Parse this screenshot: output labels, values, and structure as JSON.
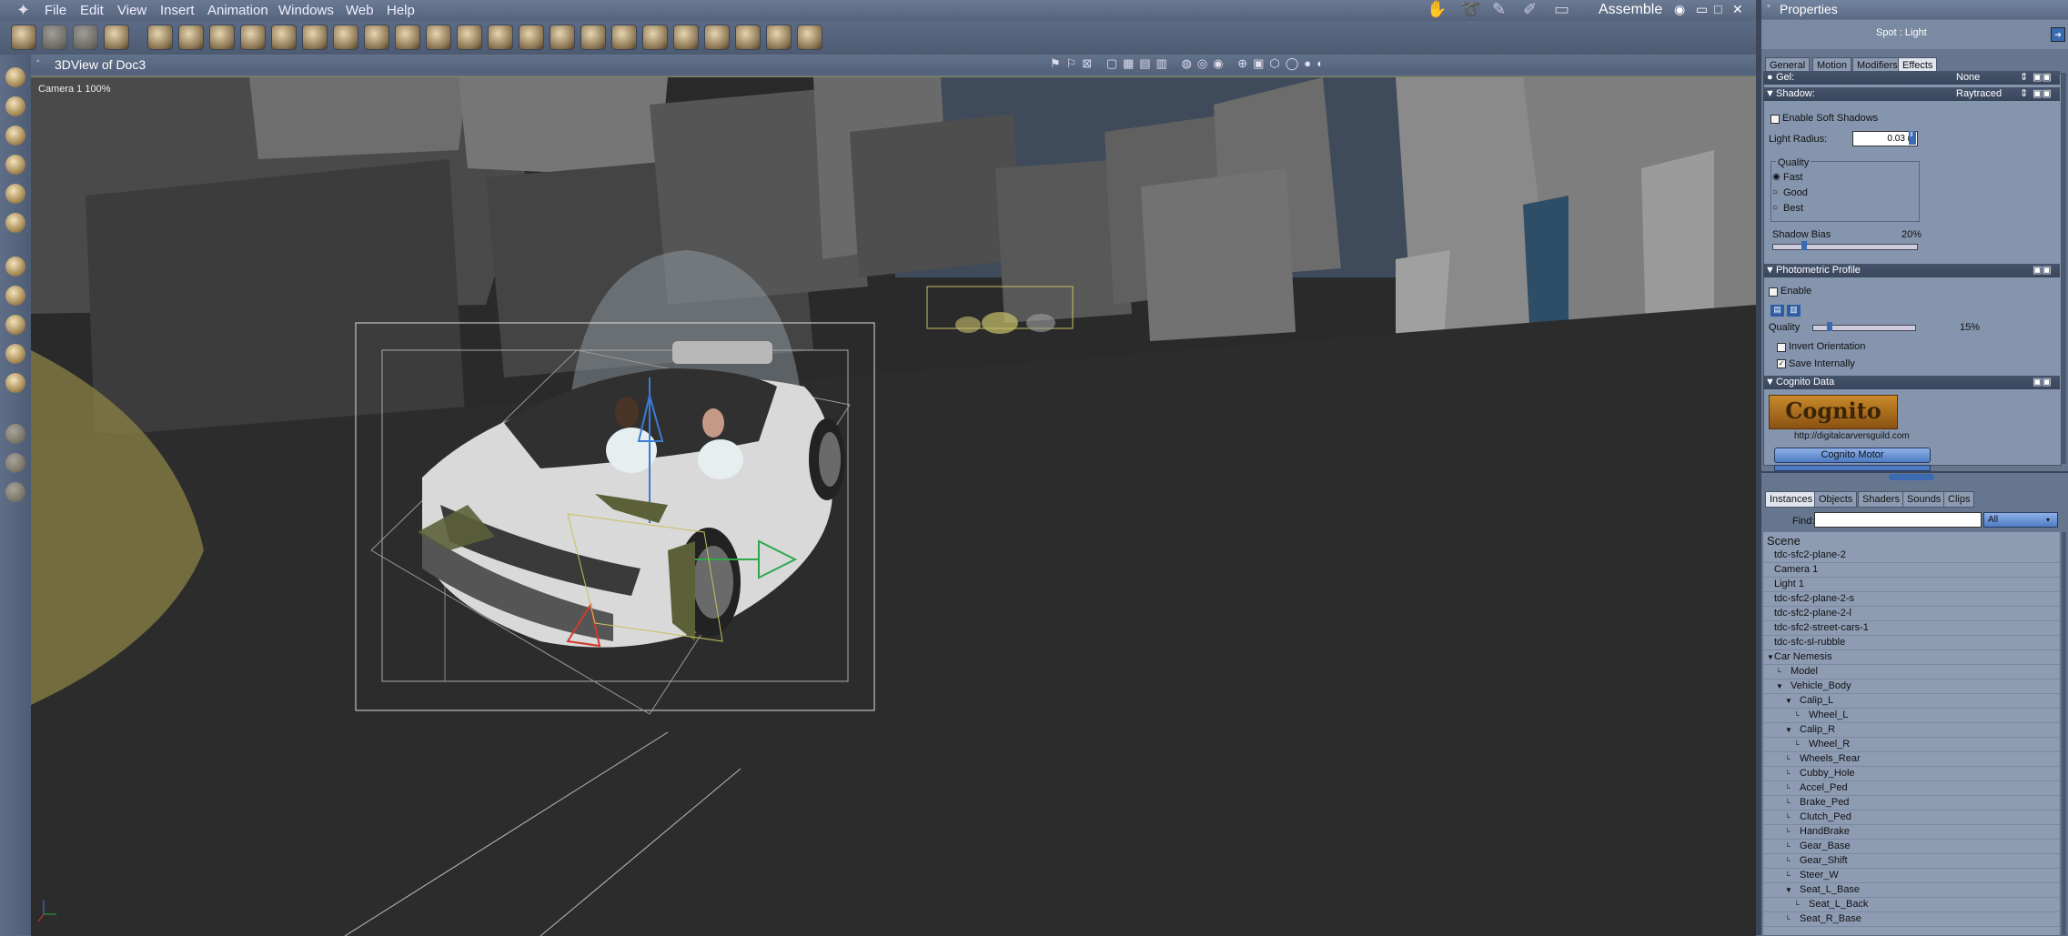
{
  "menubar": {
    "items": [
      "File",
      "Edit",
      "View",
      "Insert",
      "Animation",
      "Windows",
      "Web",
      "Help"
    ],
    "mode": "Assemble"
  },
  "viewport": {
    "title": "3DView of Doc3",
    "camera_label": "Camera 1 100%"
  },
  "properties": {
    "title": "Properties",
    "object_name": "Spot : Light",
    "tabs": [
      "General",
      "Motion",
      "Modifiers",
      "Effects"
    ],
    "active_tab": "Effects",
    "gel": {
      "label": "Gel:",
      "value": "None"
    },
    "shadow": {
      "label": "Shadow:",
      "value": "Raytraced"
    },
    "enable_soft_shadows": "Enable Soft Shadows",
    "light_radius": {
      "label": "Light Radius:",
      "value": "0.03 m"
    },
    "quality": {
      "label": "Quality",
      "options": [
        "Fast",
        "Good",
        "Best"
      ],
      "selected": "Fast"
    },
    "shadow_bias": {
      "label": "Shadow Bias",
      "value": "20%"
    },
    "photometric": {
      "title": "Photometric Profile",
      "enable": "Enable",
      "quality_label": "Quality",
      "quality_value": "15%",
      "invert": "Invert Orientation",
      "save_internally": "Save Internally"
    },
    "cognito": {
      "title": "Cognito Data",
      "logo_text": "Cognito",
      "url": "http://digitalcarversguild.com",
      "button": "Cognito Motor"
    }
  },
  "browser": {
    "tabs": [
      "Instances",
      "Objects",
      "Shaders",
      "Sounds",
      "Clips"
    ],
    "active_tab": "Instances",
    "find_label": "Find:",
    "find_value": "",
    "filter": "All",
    "scene_label": "Scene",
    "rows": [
      {
        "label": "tdc-sfc2-plane-2",
        "level": 0
      },
      {
        "label": "Camera 1",
        "level": 0
      },
      {
        "label": "Light 1",
        "level": 0
      },
      {
        "label": "tdc-sfc2-plane-2-s",
        "level": 0
      },
      {
        "label": "tdc-sfc2-plane-2-l",
        "level": 0
      },
      {
        "label": "tdc-sfc2-street-cars-1",
        "level": 0
      },
      {
        "label": "tdc-sfc-sl-rubble",
        "level": 0
      },
      {
        "label": "Car Nemesis",
        "level": 0
      },
      {
        "label": "Model",
        "level": 1
      },
      {
        "label": "Vehicle_Body",
        "level": 1
      },
      {
        "label": "Calip_L",
        "level": 2
      },
      {
        "label": "Wheel_L",
        "level": 3
      },
      {
        "label": "Calip_R",
        "level": 2
      },
      {
        "label": "Wheel_R",
        "level": 3
      },
      {
        "label": "Wheels_Rear",
        "level": 2
      },
      {
        "label": "Cubby_Hole",
        "level": 2
      },
      {
        "label": "Accel_Ped",
        "level": 2
      },
      {
        "label": "Brake_Ped",
        "level": 2
      },
      {
        "label": "Clutch_Ped",
        "level": 2
      },
      {
        "label": "HandBrake",
        "level": 2
      },
      {
        "label": "Gear_Base",
        "level": 2
      },
      {
        "label": "Gear_Shift",
        "level": 2
      },
      {
        "label": "Steer_W",
        "level": 2
      },
      {
        "label": "Seat_L_Base",
        "level": 2
      },
      {
        "label": "Seat_L_Back",
        "level": 3
      },
      {
        "label": "Seat_R_Base",
        "level": 2
      }
    ]
  }
}
